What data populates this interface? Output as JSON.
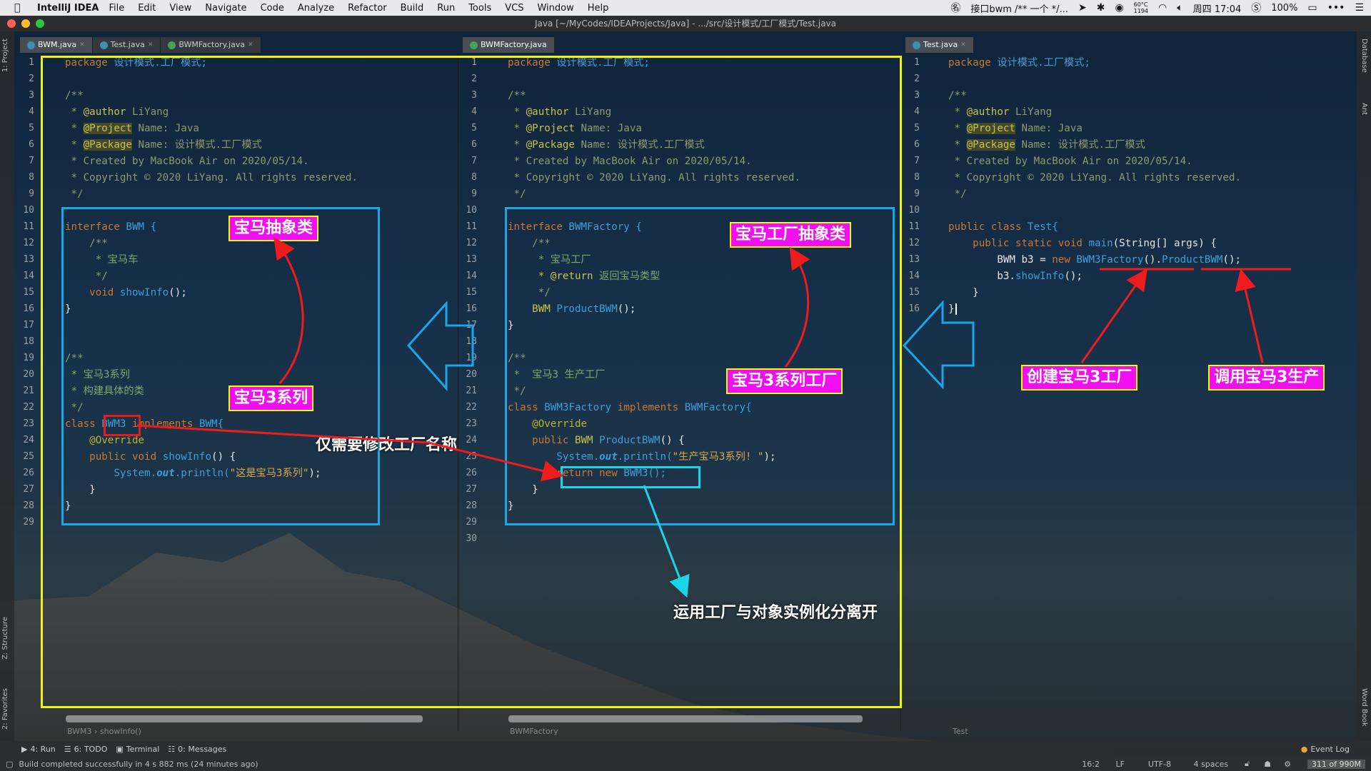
{
  "menubar": {
    "app_name": "IntelliJ IDEA",
    "items": [
      "File",
      "Edit",
      "View",
      "Navigate",
      "Code",
      "Analyze",
      "Refactor",
      "Build",
      "Run",
      "Tools",
      "VCS",
      "Window",
      "Help"
    ],
    "status_text": "接口bwm /** 一个 */...",
    "temperature": "60°C",
    "temperature_sub": "1194",
    "clock": "周四 17:04",
    "battery": "100%"
  },
  "window": {
    "title": "Java [~/MyCodes/IDEAProjects/Java] - .../src/设计模式/工厂模式/Test.java"
  },
  "left_strip": {
    "project": "1: Project",
    "structure": "Z: Structure",
    "favorites": "2: Favorites"
  },
  "right_strip": {
    "database": "Database",
    "ant": "Ant",
    "wordbook": "Word Book"
  },
  "tabs": {
    "pane1": [
      {
        "label": "BWM.java"
      },
      {
        "label": "Test.java"
      },
      {
        "label": "BWMFactory.java"
      }
    ],
    "pane2": [
      {
        "label": "BWMFactory.java"
      }
    ],
    "pane3": [
      {
        "label": "Test.java"
      }
    ]
  },
  "pane1_lines": [
    "1",
    "2",
    "3",
    "4",
    "5",
    "6",
    "7",
    "8",
    "9",
    "10",
    "11",
    "12",
    "13",
    "14",
    "15",
    "16",
    "17",
    "18",
    "19",
    "20",
    "21",
    "22",
    "23",
    "24",
    "25",
    "26",
    "27",
    "28",
    "29"
  ],
  "pane2_lines": [
    "1",
    "2",
    "3",
    "4",
    "5",
    "6",
    "7",
    "8",
    "9",
    "10",
    "11",
    "12",
    "13",
    "14",
    "15",
    "16",
    "17",
    "18",
    "19",
    "20",
    "21",
    "22",
    "23",
    "24",
    "25",
    "26",
    "27",
    "28",
    "29",
    "30"
  ],
  "pane3_lines": [
    "1",
    "2",
    "3",
    "4",
    "5",
    "6",
    "7",
    "8",
    "9",
    "10",
    "11",
    "12",
    "13",
    "14",
    "15",
    "16"
  ],
  "code_header": {
    "package_kw": "package",
    "package_name": "设计模式.工厂模式;",
    "doc_open": "/**",
    "author_tag": "@author",
    "author_val": "LiYang",
    "project_tag": "@Project",
    "project_val": "Name: Java",
    "package_tag": "@Package",
    "package_val": "Name: 设计模式.工厂模式",
    "created": "Created by MacBook Air on 2020/05/14.",
    "copyright": "Copyright © 2020 LiYang. All rights reserved.",
    "doc_close": "*/"
  },
  "pane1_code": {
    "l11_kw": "interface",
    "l11_name": "BWM {",
    "l12": "/**",
    "l13": "* 宝马车",
    "l14": "*/",
    "l15_kw": "void",
    "l15_fn": "showInfo",
    "l15_rest": "();",
    "l16": "}",
    "l19": "/**",
    "l20": "* 宝马3系列",
    "l21": "* 构建具体的类",
    "l22": "*/",
    "l23_kw": "class",
    "l23_name": "BWM3",
    "l23_impl": "implements",
    "l23_rest": "BWM{",
    "l24": "@Override",
    "l25_kw": "public void",
    "l25_fn": "showInfo",
    "l25_rest": "() {",
    "l26_sys": "System.",
    "l26_out": "out",
    "l26_fn": ".println(",
    "l26_str": "\"这是宝马3系列\"",
    "l26_end": ");",
    "l27": "}",
    "l28": "}"
  },
  "pane2_code": {
    "l11_kw": "interface",
    "l11_name": "BWMFactory {",
    "l12": "/**",
    "l13": "* 宝马工厂",
    "l14_tag": "* @return",
    "l14_txt": "返回宝马类型",
    "l15": "*/",
    "l16_type": "BWM",
    "l16_fn": "ProductBWM",
    "l16_rest": "();",
    "l17": "}",
    "l19": "/**",
    "l20": "*  宝马3 生产工厂",
    "l21": "*/",
    "l22_kw": "class",
    "l22_name": "BWM3Factory",
    "l22_impl": "implements",
    "l22_rest": "BWMFactory{",
    "l23": "@Override",
    "l24_kw": "public",
    "l24_type": "BWM",
    "l24_fn": "ProductBWM",
    "l24_rest": "() {",
    "l25_sys": "System.",
    "l25_out": "out",
    "l25_fn": ".println(",
    "l25_str": "\"生产宝马3系列! \"",
    "l25_end": ");",
    "l26_kw": "return new",
    "l26_rest": "BWM3();",
    "l27": "}",
    "l28": "}"
  },
  "pane3_code": {
    "l11_kw": "public class",
    "l11_name": "Test{",
    "l12_kw": "public static void",
    "l12_fn": "main",
    "l12_rest": "(String[] args) {",
    "l13_type": "BWM b3 =",
    "l13_kw": "new",
    "l13_factory": "BWM3Factory",
    "l13_dot": "().",
    "l13_fn": "ProductBWM",
    "l13_end": "();",
    "l14_var": "b3.",
    "l14_fn": "showInfo",
    "l14_end": "();",
    "l15": "}",
    "l16": "}"
  },
  "annotations": {
    "bmw_abstract": "宝马抽象类",
    "bmw3_series": "宝马3系列",
    "factory_abstract": "宝马工厂抽象类",
    "bmw3_factory": "宝马3系列工厂",
    "create_factory": "创建宝马3工厂",
    "call_produce": "调用宝马3生产",
    "only_change": "仅需要修改工厂名称",
    "separate": "运用工厂与对象实例化分离开"
  },
  "breadcrumbs": {
    "pane1_a": "BWM3",
    "pane1_b": "showInfo()",
    "pane2": "BWMFactory",
    "pane3": "Test"
  },
  "bottom_tools": [
    "4: Run",
    "6: TODO",
    "Terminal",
    "0: Messages"
  ],
  "event_log": "Event Log",
  "status": {
    "message": "Build completed successfully in 4 s 882 ms (24 minutes ago)",
    "position": "16:2",
    "line_sep": "LF",
    "encoding": "UTF-8",
    "indent": "4 spaces",
    "memory": "311 of 990M"
  },
  "colors": {
    "highlight_yellow": "#f2f20a",
    "box_blue": "#1aa7e8",
    "box_cyan": "#19d6e6",
    "label_magenta": "#f10ff1",
    "arrow_red": "#ee1c1c"
  }
}
